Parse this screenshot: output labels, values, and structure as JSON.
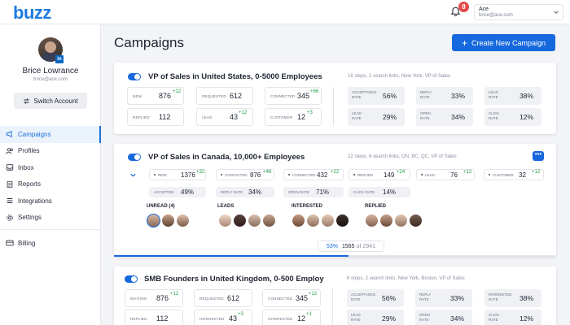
{
  "app": {
    "logo": "buzz"
  },
  "header": {
    "notification_count": "8",
    "user_name": "Ace",
    "user_email": "brice@ace.com"
  },
  "profile": {
    "name": "Brice Lowrance",
    "email": "brice@ace.com",
    "switch_label": "Switch Account",
    "badge": "in"
  },
  "nav": {
    "items": [
      "Campaigns",
      "Profiles",
      "Inbox",
      "Reports",
      "Integrations",
      "Settings"
    ],
    "billing": "Billing"
  },
  "page": {
    "title": "Campaigns",
    "create_label": "Create New Campaign"
  },
  "campaigns": [
    {
      "title": "VP of Sales in United States, 0-5000 Employees",
      "meta": "16 steps, 2 search links, New York, VP of Sales",
      "stats": [
        {
          "label": "New",
          "value": "876",
          "delta": "+12"
        },
        {
          "label": "Requested",
          "value": "612",
          "delta": ""
        },
        {
          "label": "Connected",
          "value": "345",
          "delta": "+86"
        },
        {
          "label": "Replied",
          "value": "112",
          "delta": ""
        },
        {
          "label": "Lead",
          "value": "43",
          "delta": "+12"
        },
        {
          "label": "Customer",
          "value": "12",
          "delta": "+3"
        }
      ],
      "metrics": [
        {
          "label": "Acceptance rate",
          "value": "56%"
        },
        {
          "label": "Reply rate",
          "value": "33%"
        },
        {
          "label": "Lead rate",
          "value": "38%"
        },
        {
          "label": "Lead rate",
          "value": "29%"
        },
        {
          "label": "Open rate",
          "value": "34%"
        },
        {
          "label": "Click rate",
          "value": "12%"
        }
      ]
    },
    {
      "title": "VP of Sales in Canada, 10,000+ Employees",
      "meta": "22 steps, 6 search links, ON, BC, QC, VP of Sales",
      "stats": [
        {
          "label": "New",
          "value": "1376",
          "delta": "+32"
        },
        {
          "label": "Contacted",
          "value": "876",
          "delta": "+46"
        },
        {
          "label": "Connected",
          "value": "432",
          "delta": "+22"
        },
        {
          "label": "Replied",
          "value": "149",
          "delta": "+24"
        },
        {
          "label": "Lead",
          "value": "76",
          "delta": "+12"
        },
        {
          "label": "Customer",
          "value": "32",
          "delta": "+12"
        }
      ],
      "metrics": [
        {
          "label": "Accepted",
          "value": "49%"
        },
        {
          "label": "Reply rate",
          "value": "34%"
        },
        {
          "label": "Open rate",
          "value": "71%"
        },
        {
          "label": "Click rate",
          "value": "14%"
        }
      ],
      "groups": [
        "UNREAD (4)",
        "LEADS",
        "INTERESTED",
        "REPLIED"
      ],
      "progress": {
        "percent_label": "53%",
        "fraction": 0.53,
        "done": "1565",
        "of_label": "of",
        "total": "2941"
      }
    },
    {
      "title": "SMB Founders in United Kingdom, 0-500 Employ",
      "meta": "6 steps, 2 search links, New York, Boston, VP of Sales",
      "stats": [
        {
          "label": "Waiting",
          "value": "876",
          "delta": "+12"
        },
        {
          "label": "Requested",
          "value": "612",
          "delta": ""
        },
        {
          "label": "Connected",
          "value": "345",
          "delta": "+12"
        },
        {
          "label": "Replied",
          "value": "112",
          "delta": ""
        },
        {
          "label": "Interested",
          "value": "43",
          "delta": "+3"
        },
        {
          "label": "Interested",
          "value": "12",
          "delta": "+1"
        }
      ],
      "metrics": [
        {
          "label": "Acceptance rate",
          "value": "56%"
        },
        {
          "label": "Reply rate",
          "value": "33%"
        },
        {
          "label": "Interested rate",
          "value": "38%"
        },
        {
          "label": "Lead rate",
          "value": "29%"
        },
        {
          "label": "Open rate",
          "value": "34%"
        },
        {
          "label": "Click rate",
          "value": "12%"
        }
      ]
    }
  ],
  "colors": {
    "accent": "#1668dd",
    "positive": "#1e9a45",
    "badge": "#e54848"
  }
}
